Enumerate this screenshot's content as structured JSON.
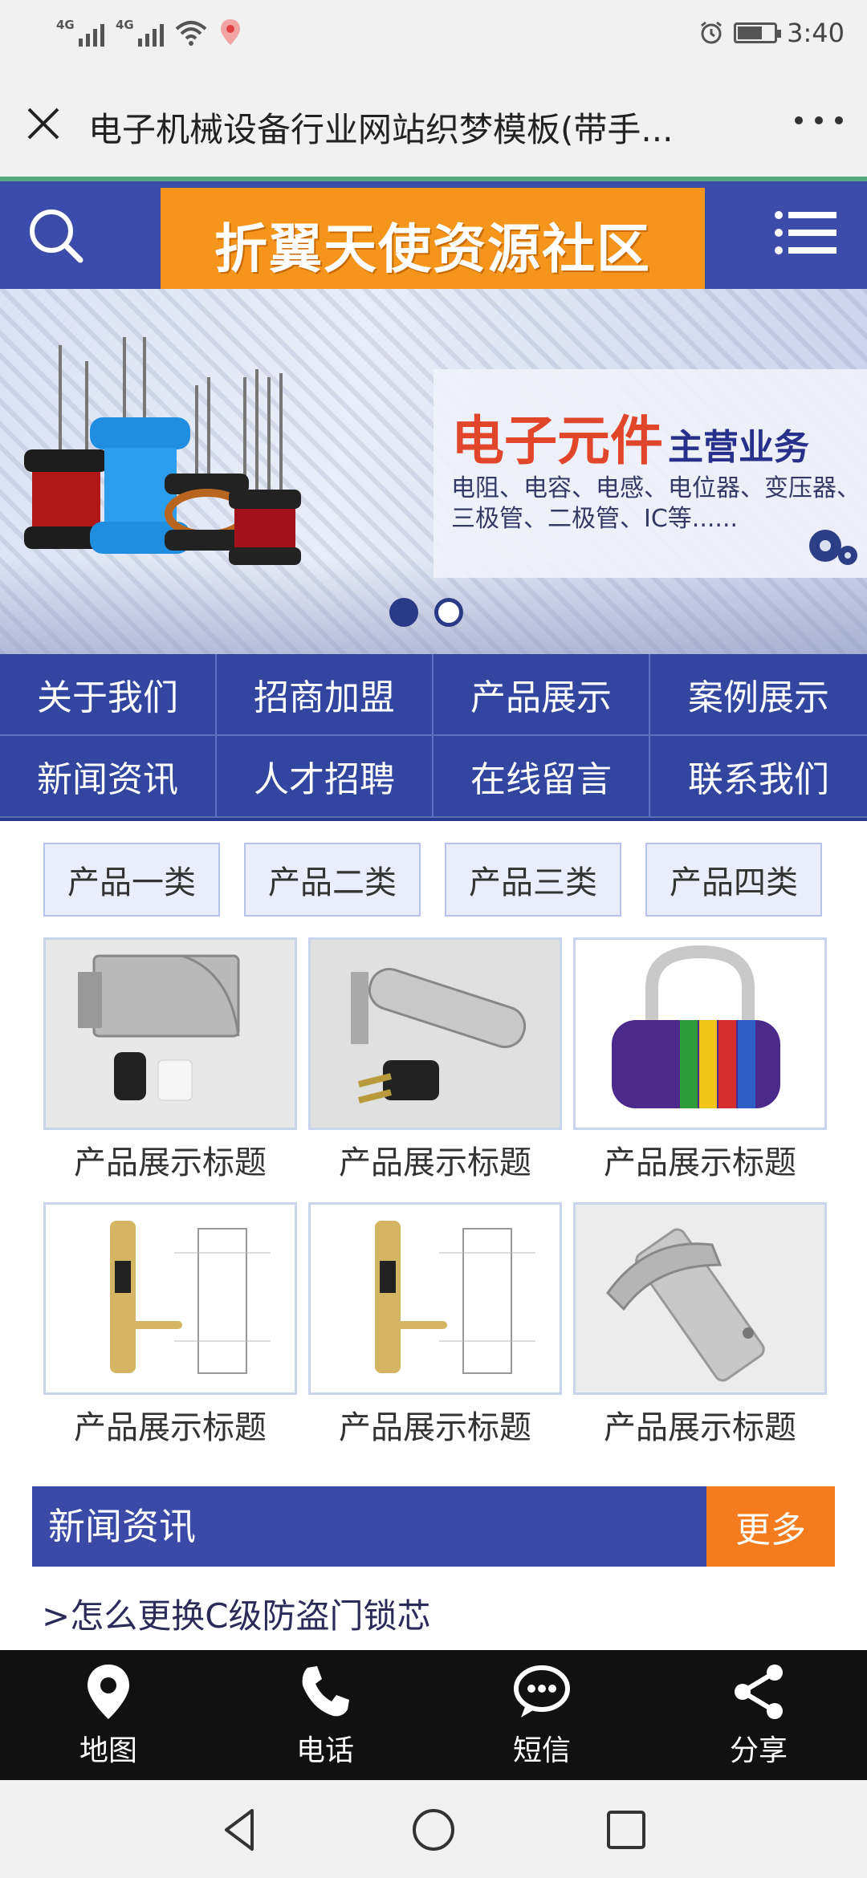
{
  "status_bar": {
    "signal1_label": "4G",
    "signal2_label": "4G",
    "time": "3:40",
    "icons": [
      "signal-icon",
      "signal-icon",
      "wifi-icon",
      "location-app-icon",
      "alarm-icon",
      "battery-icon"
    ]
  },
  "browser": {
    "title": "电子机械设备行业网站织梦模板(带手...",
    "close_icon": "close-icon",
    "more_icon": "more-icon"
  },
  "header": {
    "logo_text": "折翼天使资源社区",
    "search_icon": "search-icon",
    "menu_icon": "menu-icon"
  },
  "banner": {
    "title_red": "电子元件",
    "title_blue": "主营业务",
    "description": "电阻、电容、电感、电位器、变压器、三极管、二极管、IC等......",
    "slide_count": 2,
    "active_slide": 1
  },
  "nav": {
    "items": [
      {
        "label": "关于我们"
      },
      {
        "label": "招商加盟"
      },
      {
        "label": "产品展示"
      },
      {
        "label": "案例展示"
      },
      {
        "label": "新闻资讯"
      },
      {
        "label": "人才招聘"
      },
      {
        "label": "在线留言"
      },
      {
        "label": "联系我们"
      }
    ]
  },
  "categories": [
    {
      "label": "产品一类"
    },
    {
      "label": "产品二类"
    },
    {
      "label": "产品三类"
    },
    {
      "label": "产品四类"
    }
  ],
  "products": [
    {
      "title": "产品展示标题",
      "image": "remote-lock-image"
    },
    {
      "title": "产品展示标题",
      "image": "cylinder-lock-image"
    },
    {
      "title": "产品展示标题",
      "image": "combination-padlock-image"
    },
    {
      "title": "产品展示标题",
      "image": "fingerprint-lock-image"
    },
    {
      "title": "产品展示标题",
      "image": "fingerprint-lock-image"
    },
    {
      "title": "产品展示标题",
      "image": "door-handle-image"
    }
  ],
  "news": {
    "title": "新闻资讯",
    "more_label": "更多",
    "items": [
      {
        "text": ">怎么更换C级防盗门锁芯"
      }
    ]
  },
  "action_bar": {
    "items": [
      {
        "label": "地图",
        "icon": "map-pin-icon"
      },
      {
        "label": "电话",
        "icon": "phone-icon"
      },
      {
        "label": "短信",
        "icon": "message-icon"
      },
      {
        "label": "分享",
        "icon": "share-icon"
      }
    ]
  },
  "colors": {
    "primary_blue": "#3b4cab",
    "logo_orange": "#f5951b",
    "more_orange": "#f47b1e",
    "action_bar_bg": "#111111"
  }
}
